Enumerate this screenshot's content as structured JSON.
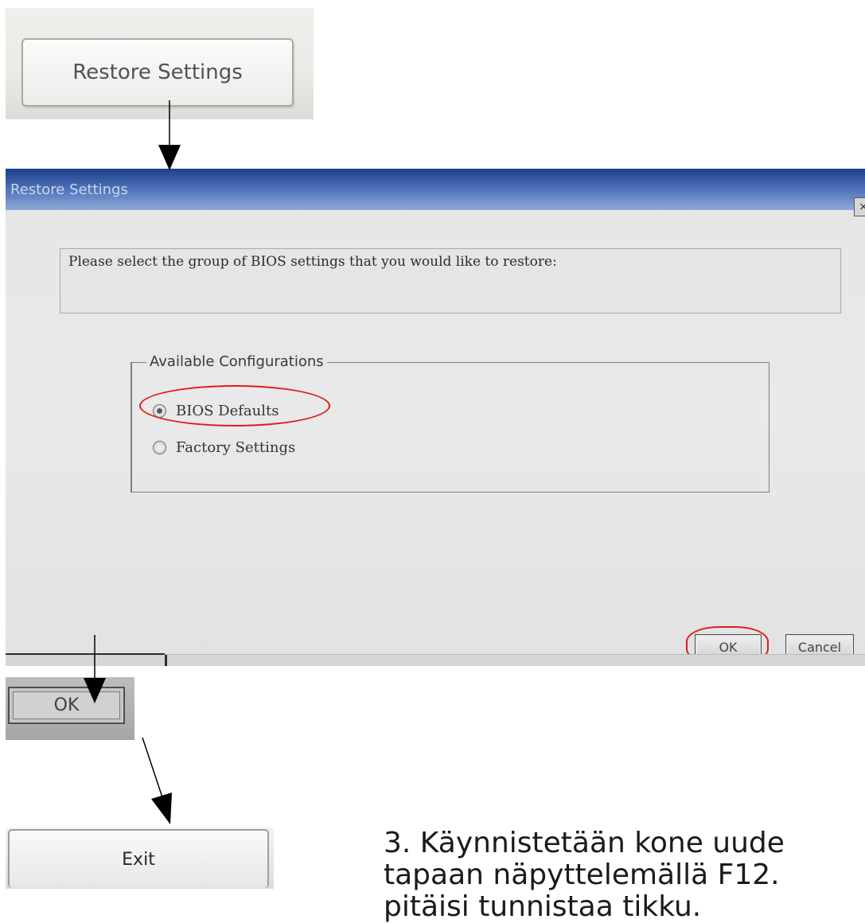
{
  "step1": {
    "button_label": "Restore Settings"
  },
  "dialog": {
    "title": "Restore Settings",
    "close_glyph": "×",
    "prompt": "Please select the group of BIOS settings that you would like to restore:",
    "group_label": "Available Configurations",
    "options": [
      {
        "label": "BIOS Defaults",
        "selected": true
      },
      {
        "label": "Factory Settings",
        "selected": false
      }
    ],
    "ok_label": "OK",
    "cancel_label": "Cancel"
  },
  "step3": {
    "button_label": "OK"
  },
  "step4": {
    "button_label": "Exit"
  },
  "caption": {
    "line1": "3. Käynnistetään kone uude",
    "line2": "tapaan näpyttelemällä F12.",
    "line3": "pitäisi tunnistaa tikku."
  },
  "colors": {
    "highlight": "#e11a1a",
    "titlebar": "#2d55a6"
  }
}
